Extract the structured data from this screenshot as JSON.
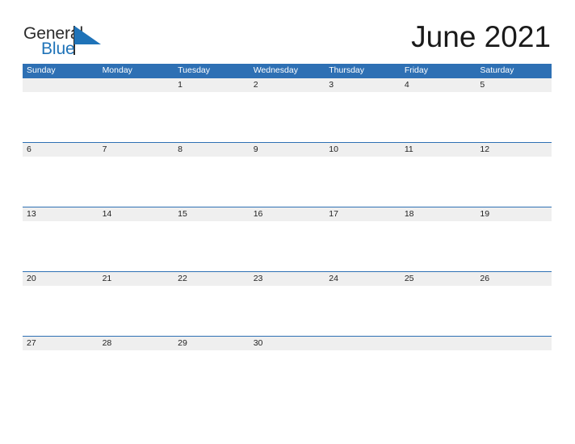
{
  "brand": {
    "line1": "General",
    "line2": "Blue",
    "accent_color": "#1f73b8",
    "text_color": "#2b2b2b",
    "triangle_icon": "logo-triangle-icon"
  },
  "header": {
    "title": "June 2021",
    "month": "June",
    "year": "2021"
  },
  "theme": {
    "header_blue": "#2e70b4",
    "band_gray": "#efefef",
    "rule_blue": "#2e70b4",
    "page_background": "#ffffff",
    "text_color": "#222222"
  },
  "calendar": {
    "weekdays": [
      "Sunday",
      "Monday",
      "Tuesday",
      "Wednesday",
      "Thursday",
      "Friday",
      "Saturday"
    ],
    "weeks": [
      {
        "days": [
          "",
          "",
          "1",
          "2",
          "3",
          "4",
          "5"
        ]
      },
      {
        "days": [
          "6",
          "7",
          "8",
          "9",
          "10",
          "11",
          "12"
        ]
      },
      {
        "days": [
          "13",
          "14",
          "15",
          "16",
          "17",
          "18",
          "19"
        ]
      },
      {
        "days": [
          "20",
          "21",
          "22",
          "23",
          "24",
          "25",
          "26"
        ]
      },
      {
        "days": [
          "27",
          "28",
          "29",
          "30",
          "",
          "",
          ""
        ]
      }
    ]
  }
}
